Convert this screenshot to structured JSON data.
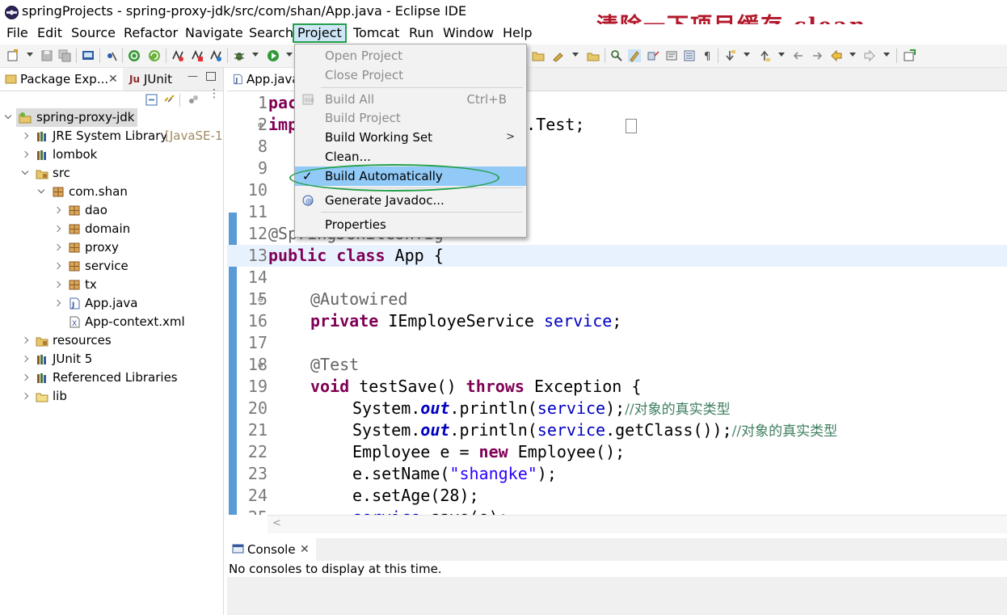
{
  "window": {
    "title": "springProjects - spring-proxy-jdk/src/com/shan/App.java - Eclipse IDE",
    "annotation": "清除一下项目缓存 clean"
  },
  "menubar": [
    "File",
    "Edit",
    "Source",
    "Refactor",
    "Navigate",
    "Search",
    "Project",
    "Tomcat",
    "Run",
    "Window",
    "Help"
  ],
  "project_menu": {
    "open_project": "Open Project",
    "close_project": "Close Project",
    "build_all": "Build All",
    "build_all_shortcut": "Ctrl+B",
    "build_project": "Build Project",
    "build_working_set": "Build Working Set",
    "clean": "Clean...",
    "build_automatically": "Build Automatically",
    "generate_javadoc": "Generate Javadoc...",
    "properties": "Properties"
  },
  "left_panel": {
    "tab_package": "Package Exp...",
    "tab_junit": "JUnit",
    "tree": {
      "project": "spring-proxy-jdk",
      "jre": "JRE System Library",
      "jre_suffix": "[JavaSE-1.",
      "lombok": "lombok",
      "src": "src",
      "package": "com.shan",
      "dao": "dao",
      "domain": "domain",
      "proxy": "proxy",
      "service": "service",
      "tx": "tx",
      "app_java": "App.java",
      "app_context": "App-context.xml",
      "resources": "resources",
      "junit5": "JUnit 5",
      "referenced": "Referenced Libraries",
      "lib": "lib"
    }
  },
  "editor": {
    "tab": "App.java",
    "lines": {
      "n1": "1",
      "n2": "2",
      "n8": "8",
      "n9": "9",
      "n10": "10",
      "n11": "11",
      "n12": "12",
      "n13": "13",
      "n14": "14",
      "n15": "15",
      "n16": "16",
      "n17": "17",
      "n18": "18",
      "n19": "19",
      "n20": "20",
      "n21": "21",
      "n22": "22",
      "n23": "23",
      "n24": "24",
      "n25": "25"
    },
    "code": {
      "l1_kw": "pac",
      "l2_kw": "imp",
      "l2_rest": ".api.Test;",
      "l12": "@SpringJUnitConfig",
      "l13_kw1": "public",
      "l13_kw2": "class",
      "l13_rest": " App {",
      "l15": "@Autowired",
      "l16_kw": "private",
      "l16_type": " IEmployeService ",
      "l16_field": "service",
      "l16_end": ";",
      "l18": "@Test",
      "l19_kw": "void",
      "l19_mid": " testSave() ",
      "l19_kw2": "throws",
      "l19_end": " Exception {",
      "sys": "System.",
      "out": "out",
      "println": ".println(",
      "l20_end": ");",
      "comment": "//对象的真实类型",
      "l21_mid": ".getClass());",
      "l22_a": "Employee ",
      "l22_var": "e",
      "l22_b": " = ",
      "l22_kw": "new",
      "l22_c": " Employee();",
      "l23_a": "e.setName(",
      "l23_str": "\"shangke\"",
      "l23_b": ");",
      "l24": "e.setAge(28);",
      "l25_a": "service",
      "l25_b": ".save(e);"
    }
  },
  "console": {
    "tab": "Console",
    "message": "No consoles to display at this time."
  },
  "colors": {
    "annotation": "#b2182b",
    "highlight_circle": "#23a04a",
    "menu_highlight": "#91c9f7",
    "keyword": "#7f0055"
  }
}
